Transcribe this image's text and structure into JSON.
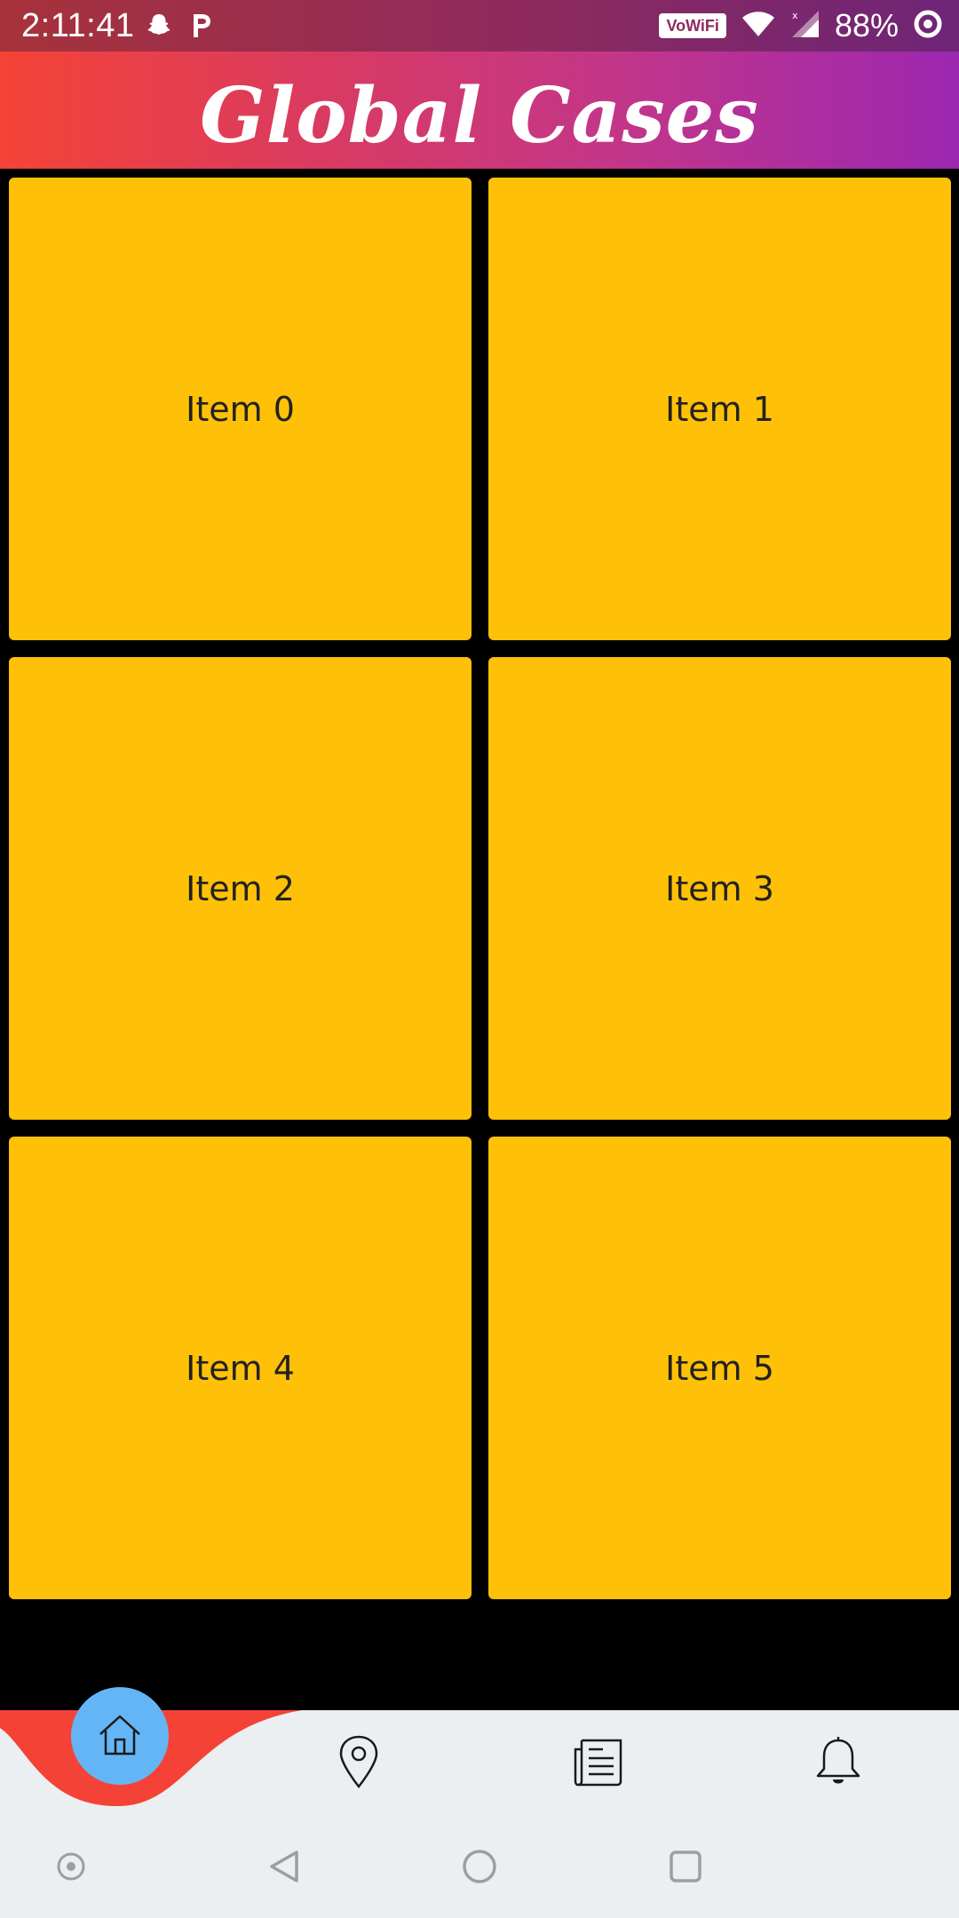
{
  "status_bar": {
    "time": "2:11:41",
    "vowifi_label": "VoWiFi",
    "battery_percent": "88%",
    "icons": [
      "snapchat-icon",
      "p-app-icon",
      "wifi-icon",
      "signal-icon",
      "battery-ring-icon"
    ]
  },
  "app_bar": {
    "title": "Global Cases",
    "gradient_colors": [
      "#f44336",
      "#9c27b0"
    ]
  },
  "grid": {
    "tile_color": "#ffc107",
    "items": [
      {
        "label": "Item 0"
      },
      {
        "label": "Item 1"
      },
      {
        "label": "Item 2"
      },
      {
        "label": "Item 3"
      },
      {
        "label": "Item 4"
      },
      {
        "label": "Item 5"
      }
    ]
  },
  "bottom_nav": {
    "active_index": 0,
    "accent_color": "#f44336",
    "fab_color": "#64b5f6",
    "items": [
      "home-icon",
      "location-pin-icon",
      "news-icon",
      "bell-icon"
    ]
  },
  "system_nav": {
    "buttons": [
      "assistant-dot-icon",
      "back-icon",
      "home-circle-icon",
      "recents-icon"
    ]
  }
}
